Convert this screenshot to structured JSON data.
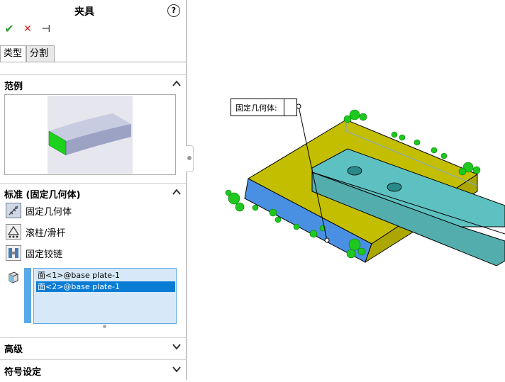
{
  "panel": {
    "title": "夹具",
    "help_icon": "?",
    "ok_icon": "✔",
    "cancel_icon": "✕",
    "pin_icon": "⊣",
    "tabs": [
      "类型",
      "分割"
    ],
    "sections": {
      "example": "范例",
      "standard": "标准 (固定几何体)",
      "advanced": "高级",
      "symbol": "符号设定"
    },
    "options": [
      {
        "label": "固定几何体",
        "icon": "fixed-geometry-icon",
        "selected": true
      },
      {
        "label": "滚柱/滑杆",
        "icon": "roller-slider-icon",
        "selected": false
      },
      {
        "label": "固定铰链",
        "icon": "fixed-hinge-icon",
        "selected": false
      }
    ],
    "faces": [
      {
        "label": "面<1>@base plate-1",
        "selected": false
      },
      {
        "label": "面<2>@base plate-1",
        "selected": true
      }
    ]
  },
  "viewport": {
    "callout_label": "固定几何体:"
  },
  "colors": {
    "plate": "#c3bf00",
    "bar": "#5ec1c1",
    "selected_face": "#4a90e2",
    "fixture_marker": "#1ec81e",
    "list_selection": "#0a7cd4"
  }
}
